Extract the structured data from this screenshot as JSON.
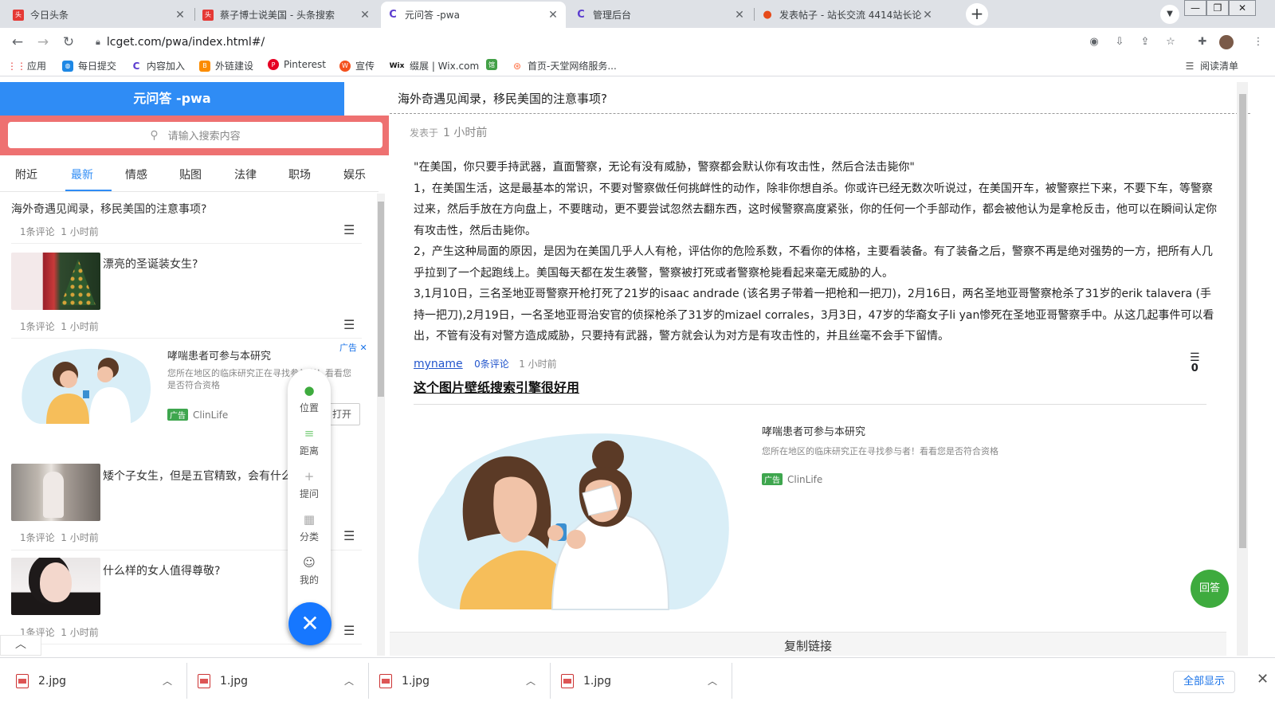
{
  "browser": {
    "tabs": [
      {
        "title": "今日头条",
        "favicon_color": "#e53935",
        "favicon_text": "头条"
      },
      {
        "title": "蔡子博士说美国 - 头条搜索",
        "favicon_color": "#e53935",
        "favicon_text": "头条"
      },
      {
        "title": "元问答 -pwa",
        "favicon_color": "#5b3ccf",
        "favicon_text": "C"
      },
      {
        "title": "管理后台",
        "favicon_color": "#5b3ccf",
        "favicon_text": "C"
      },
      {
        "title": "发表帖子 - 站长交流 4414站长论",
        "favicon_color": "#e64a19",
        "favicon_text": "●"
      }
    ],
    "url": "lcget.com/pwa/index.html#/",
    "bookmarks": [
      {
        "label": "应用",
        "color": "#e53935",
        "icon": "grid"
      },
      {
        "label": "每日提交",
        "color": "#1e88e5",
        "icon": "globe"
      },
      {
        "label": "内容加入",
        "color": "#5b3ccf",
        "icon": "C"
      },
      {
        "label": "外链建设",
        "color": "#fb8c00",
        "icon": "B"
      },
      {
        "label": "Pinterest",
        "color": "#e60023",
        "icon": "P"
      },
      {
        "label": "宣传",
        "color": "#f4511e",
        "icon": "W"
      },
      {
        "label": "缀展 | Wix.com",
        "color": "#111111",
        "icon": "Wix"
      },
      {
        "label": "",
        "color": "#43a047",
        "icon": "馆"
      },
      {
        "label": "首页-天堂网络服务...",
        "color": "#ff7043",
        "icon": "网"
      }
    ],
    "reading_list": "阅读清单"
  },
  "app": {
    "title": "元问答 -pwa",
    "search_placeholder": "请输入搜索内容",
    "categories": [
      "附近",
      "最新",
      "情感",
      "贴图",
      "法律",
      "职场",
      "娱乐"
    ],
    "active_category": "最新",
    "feed": [
      {
        "title": "海外奇遇见闻录，移民美国的注意事项?",
        "comments": "1条评论",
        "time": "1 小时前"
      },
      {
        "title": "漂亮的圣诞装女生?",
        "comments": "1条评论",
        "time": "1 小时前"
      },
      {
        "title": "矮个子女生，但是五官精致，会有什么困扰?",
        "comments": "1条评论",
        "time": "1 小时前"
      },
      {
        "title": "什么样的女人值得尊敬?",
        "comments": "1条评论",
        "time": "1 小时前"
      }
    ],
    "ad": {
      "title": "哮喘患者可参与本研究",
      "desc": "您所在地区的临床研究正在寻找参与者！看看您是否符合资格",
      "badge": "广告",
      "source": "ClinLife",
      "open": "打开",
      "ad_tag": "广告"
    },
    "fab_menu": [
      "位置",
      "距离",
      "提问",
      "分类",
      "我的"
    ]
  },
  "article": {
    "title": "海外奇遇见闻录，移民美国的注意事项?",
    "posted_label": "发表于",
    "posted_time": "1 小时前",
    "paragraphs": [
      "\"在美国，你只要手持武器，直面警察，无论有没有威胁，警察都会默认你有攻击性，然后合法击毙你\"",
      "1，在美国生活，这是最基本的常识，不要对警察做任何挑衅性的动作，除非你想自杀。你或许已经无数次听说过，在美国开车，被警察拦下来，不要下车，等警察过来，然后手放在方向盘上，不要瞎动，更不要尝试忽然去翻东西，这时候警察高度紧张，你的任何一个手部动作，都会被他认为是拿枪反击，他可以在瞬间认定你有攻击性，然后击毙你。",
      "2，产生这种局面的原因，是因为在美国几乎人人有枪，评估你的危险系数，不看你的体格，主要看装备。有了装备之后，警察不再是绝对强势的一方，把所有人几乎拉到了一个起跑线上。美国每天都在发生袭警，警察被打死或者警察枪毙看起来毫无威胁的人。",
      "3,1月10日，三名圣地亚哥警察开枪打死了21岁的isaac andrade (该名男子带着一把枪和一把刀)，2月16日，两名圣地亚哥警察枪杀了31岁的erik talavera (手持一把刀),2月19日，一名圣地亚哥治安官的侦探枪杀了31岁的mizael corrales，3月3日，47岁的华裔女子li yan惨死在圣地亚哥警察手中。从这几起事件可以看出，不管有没有对警方造成威胁，只要持有武器，警方就会认为对方是有攻击性的，并且丝毫不会手下留情。"
    ],
    "author": "myname",
    "comments": "0条评论",
    "time": "1 小时前",
    "count": "0",
    "link_title": "这个图片壁纸搜索引擎很好用",
    "copy_link": "复制链接",
    "answer_button": "回答"
  },
  "downloads": {
    "files": [
      "2.jpg",
      "1.jpg",
      "1.jpg",
      "1.jpg"
    ],
    "show_all": "全部显示"
  }
}
